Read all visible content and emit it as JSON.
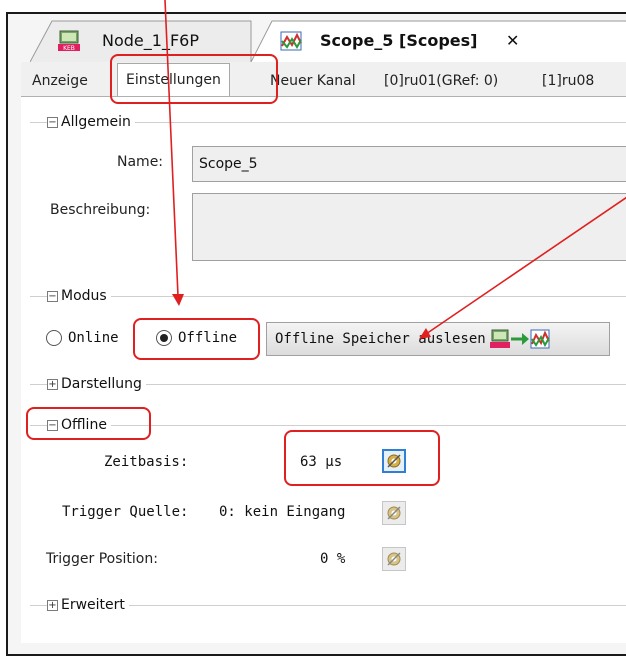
{
  "doc_tabs": [
    {
      "label": "Node_1_F6P"
    },
    {
      "label": "Scope_5 [Scopes]",
      "close": "✕"
    }
  ],
  "sub_tabs": [
    "Anzeige",
    "Einstellungen",
    "Neuer Kanal",
    "[0]ru01(GRef: 0)",
    "[1]ru08"
  ],
  "allgemein": {
    "title": "Allgemein",
    "name_label": "Name:",
    "name_value": "Scope_5",
    "desc_label": "Beschreibung:",
    "desc_value": ""
  },
  "modus": {
    "title": "Modus",
    "online_label": "Online",
    "offline_label": "Offline",
    "selected": "Offline",
    "read_button": "Offline Speicher auslesen"
  },
  "darstellung": {
    "title": "Darstellung"
  },
  "offline": {
    "title": "Offline",
    "zeitbasis_label": "Zeitbasis:",
    "zeitbasis_value": "63 µs",
    "trigger_quelle_label": "Trigger Quelle:",
    "trigger_quelle_value": "0: kein Eingang",
    "trigger_position_label": "Trigger Position:",
    "trigger_position_value": "0 %"
  },
  "erweitert": {
    "title": "Erweitert"
  },
  "icons": {
    "keb": "keb-device-icon",
    "scope": "scope-chart-icon",
    "gear": "gear-icon",
    "arrow": "arrow-right-icon"
  },
  "colors": {
    "highlight": "#e02020",
    "focus": "#2f7fd3",
    "arrow_green": "#2a9a3a"
  }
}
